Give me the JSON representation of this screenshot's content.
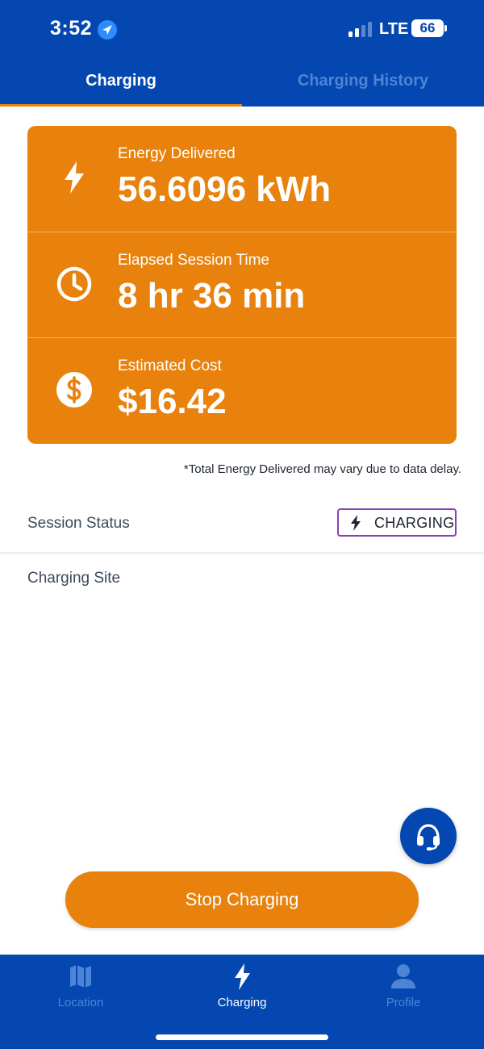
{
  "status_bar": {
    "time": "3:52",
    "network": "LTE",
    "battery": "66"
  },
  "tabs": [
    {
      "label": "Charging",
      "active": true
    },
    {
      "label": "Charging History",
      "active": false
    }
  ],
  "stats": {
    "energy": {
      "label": "Energy Delivered",
      "value": "56.6096 kWh",
      "icon": "bolt-icon"
    },
    "time": {
      "label": "Elapsed Session Time",
      "value": "8 hr 36 min",
      "icon": "clock-icon"
    },
    "cost": {
      "label": "Estimated Cost",
      "value": "$16.42",
      "icon": "dollar-icon"
    }
  },
  "disclaimer": "*Total Energy Delivered may vary due to data delay.",
  "session": {
    "label": "Session Status",
    "status": "CHARGING"
  },
  "site": {
    "label": "Charging Site"
  },
  "actions": {
    "stop_label": "Stop Charging",
    "support_icon": "headset-icon"
  },
  "nav": [
    {
      "label": "Location",
      "icon": "map-icon",
      "active": false
    },
    {
      "label": "Charging",
      "icon": "bolt-icon",
      "active": true
    },
    {
      "label": "Profile",
      "icon": "user-icon",
      "active": false
    }
  ],
  "colors": {
    "brand_blue": "#0447b0",
    "accent_orange": "#e8820c",
    "inactive_blue": "#4d84d6",
    "badge_border": "#8a3fb8"
  }
}
